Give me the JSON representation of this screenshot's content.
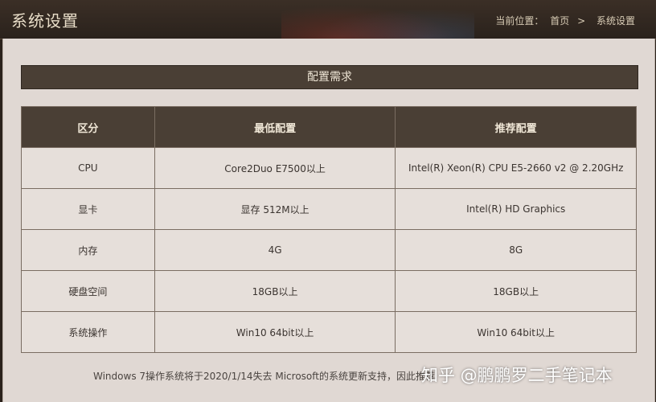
{
  "header": {
    "title": "系统设置",
    "breadcrumb": {
      "prefix": "当前位置：",
      "home": "首页",
      "separator": ">",
      "current": "系统设置"
    }
  },
  "section": {
    "title": "配置需求"
  },
  "table": {
    "headers": [
      "区分",
      "最低配置",
      "推荐配置"
    ],
    "rows": [
      [
        "CPU",
        "Core2Duo E7500以上",
        "Intel(R) Xeon(R) CPU E5-2660 v2 @ 2.20GHz"
      ],
      [
        "显卡",
        "显存 512M以上",
        "Intel(R) HD Graphics"
      ],
      [
        "内存",
        "4G",
        "8G"
      ],
      [
        "硬盘空间",
        "18GB以上",
        "18GB以上"
      ],
      [
        "系统操作",
        "Win10 64bit以上",
        "Win10 64bit以上"
      ]
    ]
  },
  "footnote": "Windows 7操作系统将于2020/1/14失去 Microsoft的系统更新支持，因此推荐",
  "watermark": "知乎 @鹏鹏罗二手笔记本"
}
